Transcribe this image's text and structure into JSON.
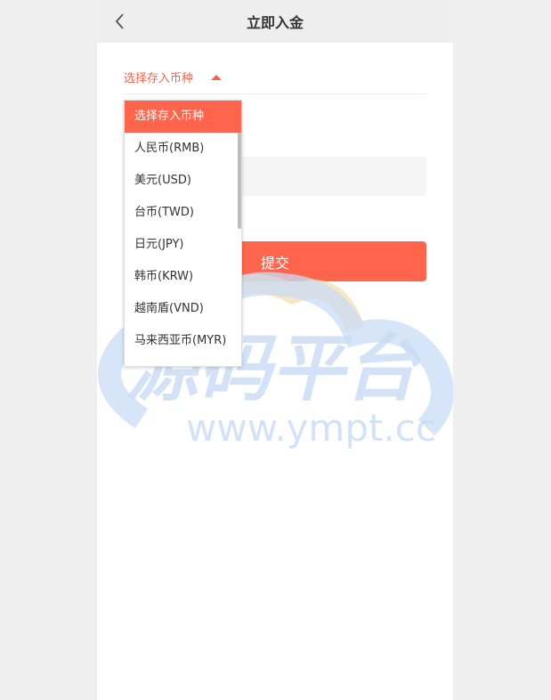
{
  "header": {
    "title": "立即入金",
    "back_icon": "chevron-left-icon"
  },
  "form": {
    "currency_select": {
      "label": "选择存入币种"
    },
    "submit_label": "提交"
  },
  "dropdown": {
    "options": [
      "选择存入币种",
      "人民币(RMB)",
      "美元(USD)",
      "台币(TWD)",
      "日元(JPY)",
      "韩币(KRW)",
      "越南盾(VND)",
      "马来西亚币(MYR)"
    ],
    "selected_index": 0
  },
  "watermark": {
    "main": "源码平台",
    "url": "www.ympt.cc"
  },
  "colors": {
    "accent": "#ff654c",
    "accent_text": "#f0654b",
    "header_bg": "#eeeeee",
    "page_bg": "#efefef",
    "watermark_blue": "#c9dcf5",
    "watermark_orange": "#f9dba8"
  }
}
